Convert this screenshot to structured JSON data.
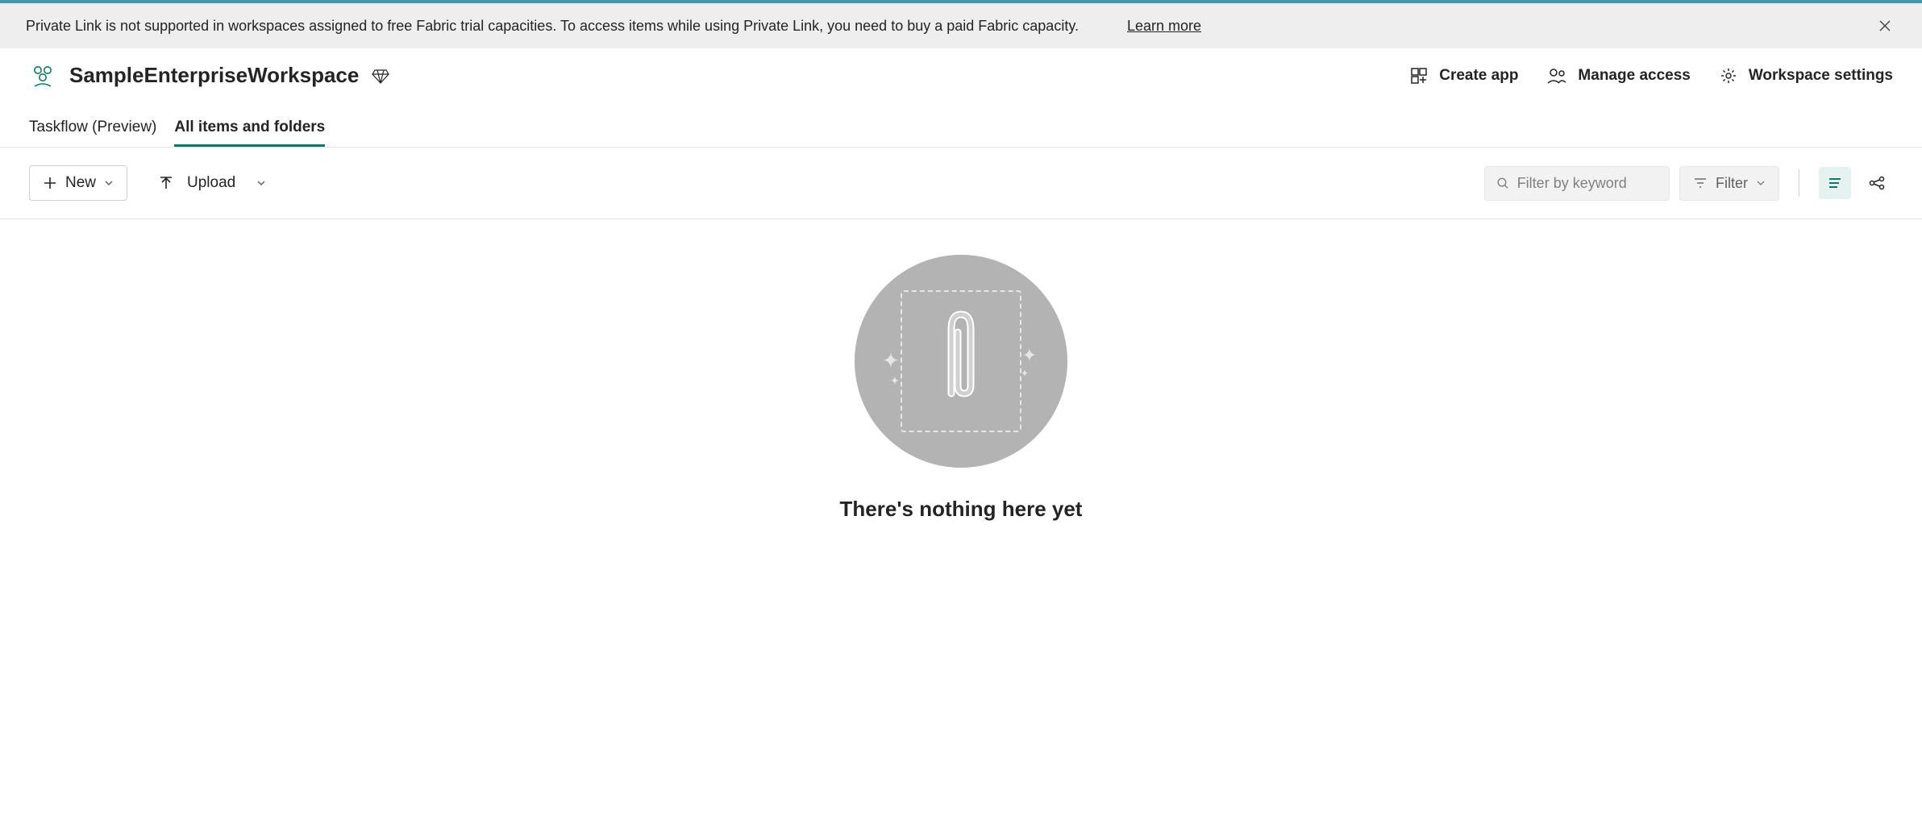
{
  "banner": {
    "message": "Private Link is not supported in workspaces assigned to free Fabric trial capacities. To access items while using Private Link, you need to buy a paid Fabric capacity.",
    "link_label": "Learn more"
  },
  "workspace": {
    "title": "SampleEnterpriseWorkspace"
  },
  "header_actions": {
    "create_app": "Create app",
    "manage_access": "Manage access",
    "settings": "Workspace settings"
  },
  "tabs": {
    "taskflow": "Taskflow (Preview)",
    "all_items": "All items and folders"
  },
  "toolbar": {
    "new_label": "New",
    "upload_label": "Upload",
    "filter_placeholder": "Filter by keyword",
    "filter_button": "Filter"
  },
  "empty_state": {
    "title": "There's nothing here yet"
  }
}
